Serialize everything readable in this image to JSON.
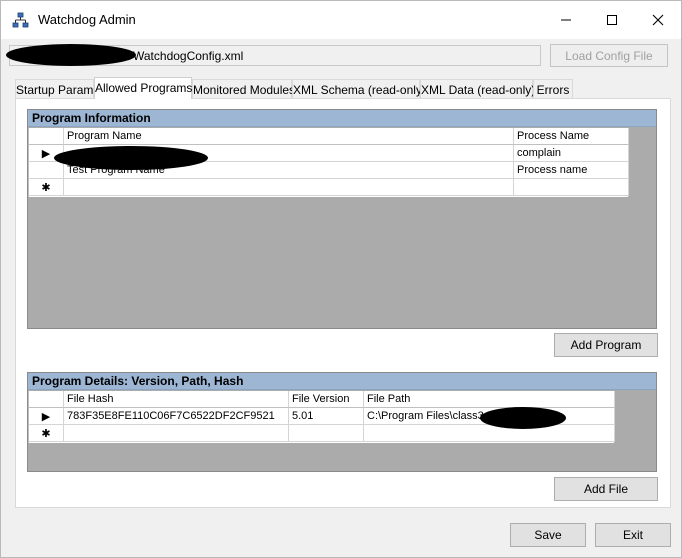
{
  "window": {
    "title": "Watchdog Admin",
    "icons": {
      "app": "network-tree-icon",
      "minimize": "minimize-icon",
      "maximize": "maximize-icon",
      "close": "close-icon"
    }
  },
  "config": {
    "path_suffix": "WatchdogConfig.xml",
    "load_button": "Load Config File"
  },
  "tabs": [
    {
      "label": "Startup Param",
      "active": false
    },
    {
      "label": "Allowed Programs",
      "active": true
    },
    {
      "label": "Monitored Modules",
      "active": false
    },
    {
      "label": "XML Schema (read-only)",
      "active": false
    },
    {
      "label": "XML Data (read-only)",
      "active": false
    },
    {
      "label": "Errors",
      "active": false
    }
  ],
  "program_info": {
    "title": "Program Information",
    "columns": [
      "Program Name",
      "Process Name"
    ],
    "rows": [
      {
        "marker": "▶",
        "program_name": "",
        "process_name": "complain"
      },
      {
        "marker": "",
        "program_name": "Test Program Name",
        "process_name": "Process name"
      },
      {
        "marker": "✱",
        "program_name": "",
        "process_name": ""
      }
    ],
    "add_button": "Add Program"
  },
  "program_details": {
    "title": "Program Details: Version, Path, Hash",
    "columns": [
      "File Hash",
      "File Version",
      "File Path"
    ],
    "rows": [
      {
        "marker": "▶",
        "file_hash": "783F35E8FE110C06F7C6522DF2CF9521",
        "file_version": "5.01",
        "file_path": "C:\\Program Files\\class3"
      },
      {
        "marker": "✱",
        "file_hash": "",
        "file_version": "",
        "file_path": ""
      }
    ],
    "add_button": "Add File"
  },
  "footer": {
    "save": "Save",
    "exit": "Exit"
  },
  "colors": {
    "group_header": "#9cb6d4",
    "grid_background": "#ababab",
    "window_background": "#f0f0f0"
  }
}
